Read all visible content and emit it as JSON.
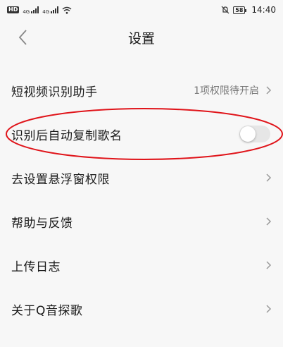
{
  "status_bar": {
    "hd": "HD",
    "hd_sub": "2",
    "net1": "4G",
    "net2": "4G",
    "battery": "58",
    "time": "14:40",
    "icons": [
      "wifi-icon",
      "mute-icon"
    ]
  },
  "nav": {
    "title": "设置",
    "back_icon": "chevron-left-icon"
  },
  "settings": [
    {
      "label": "短视频识别助手",
      "value": "1项权限待开启",
      "control": "chevron"
    },
    {
      "label": "识别后自动复制歌名",
      "control": "toggle",
      "toggle_on": false
    },
    {
      "label": "去设置悬浮窗权限",
      "control": "chevron"
    },
    {
      "label": "帮助与反馈",
      "control": "chevron"
    },
    {
      "label": "上传日志",
      "control": "chevron"
    },
    {
      "label": "关于Q音探歌",
      "control": "chevron"
    }
  ],
  "colors": {
    "annotation": "#e0141a",
    "toggle_off": "#e6e6e6",
    "background": "#f7f7f7"
  }
}
